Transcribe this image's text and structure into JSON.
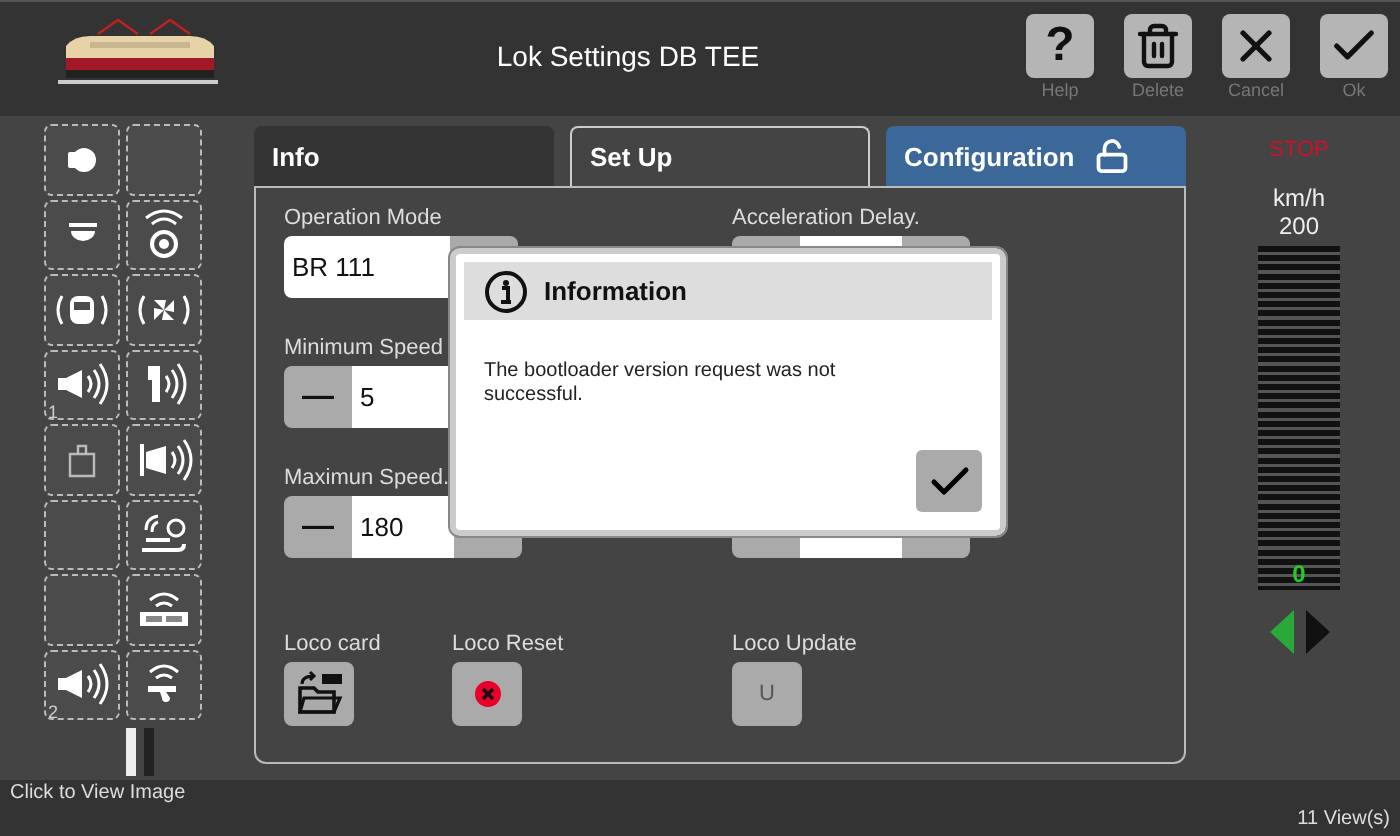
{
  "window": {
    "title": "Lok Settings DB TEE"
  },
  "toolbar": [
    {
      "glyph": "?",
      "kind": "help",
      "label": "Help"
    },
    {
      "kind": "delete",
      "label": "Delete"
    },
    {
      "kind": "cancel",
      "label": "Cancel"
    },
    {
      "kind": "ok",
      "label": "Ok"
    }
  ],
  "functions": [
    {
      "kind": "headlight"
    },
    {
      "kind": "empty"
    },
    {
      "kind": "lamp"
    },
    {
      "kind": "speaker"
    },
    {
      "kind": "cab"
    },
    {
      "kind": "fan"
    },
    {
      "kind": "horn",
      "number": "1"
    },
    {
      "kind": "door"
    },
    {
      "kind": "weight"
    },
    {
      "kind": "megaphone"
    },
    {
      "kind": "empty"
    },
    {
      "kind": "crane"
    },
    {
      "kind": "empty"
    },
    {
      "kind": "wagon"
    },
    {
      "kind": "horn",
      "number": "2"
    },
    {
      "kind": "whistle"
    }
  ],
  "tabs": [
    {
      "label": "Info",
      "selected": false,
      "kind": "plain"
    },
    {
      "label": "Set Up",
      "selected": true,
      "kind": "plain"
    },
    {
      "label": "Configuration",
      "selected": false,
      "kind": "locked"
    }
  ],
  "setup": {
    "left": [
      {
        "kind": "select",
        "label": "Operation Mode",
        "value": "BR 111"
      },
      {
        "kind": "stepper",
        "label": "Minimum Speed",
        "minus": "—",
        "value": "5"
      },
      {
        "kind": "stepper",
        "label": "Maximun Speed.",
        "minus": "—",
        "value": "180",
        "plus": true
      }
    ],
    "right": [
      {
        "kind": "stepper",
        "label": "Acceleration Delay.",
        "plus": true
      },
      {
        "kind": "stepper",
        "plus": true
      }
    ],
    "actions": [
      {
        "label": "Loco card",
        "kind": "card"
      },
      {
        "label": "Loco Reset",
        "kind": "reset"
      },
      {
        "label": "Loco Update",
        "kind": "update",
        "glyph": "U"
      }
    ]
  },
  "dialog": {
    "title": "Information",
    "message": "The bootloader version request was not successful."
  },
  "speed": {
    "status": "STOP",
    "unit": "km/h",
    "max": "200",
    "reading": "0",
    "directions": [
      {
        "kind": "reverse",
        "selected": true
      },
      {
        "kind": "forward",
        "selected": false
      }
    ]
  },
  "footer": {
    "link": "Click to View Image",
    "views": "11 View(s)"
  }
}
